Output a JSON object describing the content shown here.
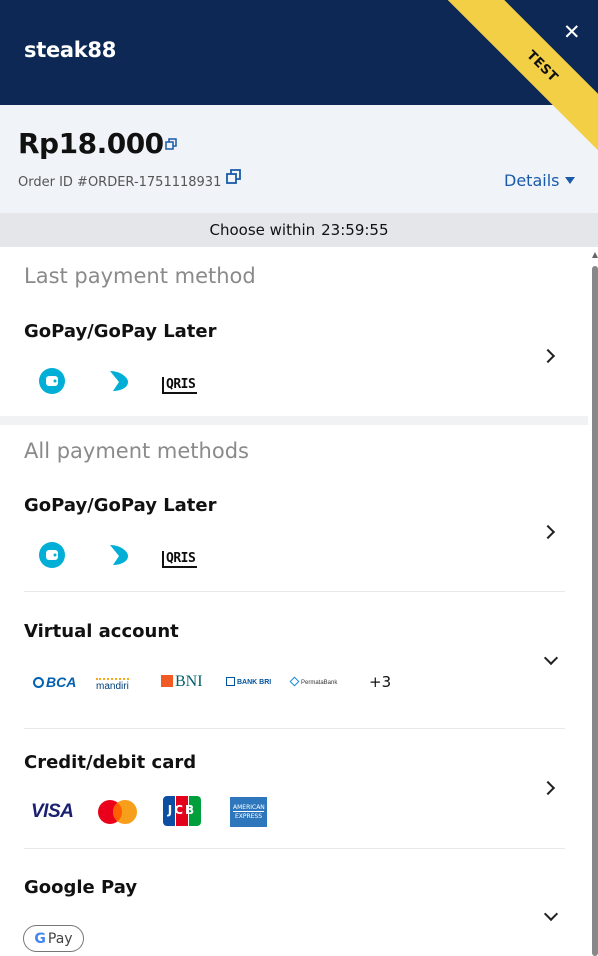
{
  "header": {
    "merchant": "steak88",
    "close_label": "✕",
    "badge": "TEST"
  },
  "summary": {
    "amount": "Rp18.000",
    "order_id": "Order ID #ORDER-1751118931",
    "details_label": "Details"
  },
  "timer": {
    "prefix": "Choose within",
    "countdown": "23:59:55"
  },
  "last_section": {
    "label": "Last payment method",
    "methods": [
      {
        "title": "GoPay/GoPay Later",
        "icons": [
          "gopay-wallet-icon",
          "gopay-later-icon",
          "qris-logo"
        ]
      }
    ]
  },
  "all_section": {
    "label": "All payment methods",
    "methods": [
      {
        "title": "GoPay/GoPay Later",
        "icons": [
          "gopay-wallet-icon",
          "gopay-later-icon",
          "qris-logo"
        ]
      },
      {
        "title": "Virtual account",
        "banks": [
          "BCA",
          "mandiri",
          "BNI",
          "BANK BRI",
          "Permata Bank"
        ],
        "more": "+3"
      },
      {
        "title": "Credit/debit card",
        "cards": [
          "VISA",
          "mastercard",
          "JCB",
          "AMERICAN EXPRESS"
        ]
      },
      {
        "title": "Google Pay",
        "badge": "Pay",
        "badge_g": "G"
      }
    ]
  },
  "logos": {
    "qris": "QRIS",
    "bca": "BCA",
    "mandiri": "mandiri",
    "bni": "BNI",
    "bri": "BANK BRI",
    "permata": "PermataBank",
    "visa": "VISA",
    "jcb": "JCB",
    "amex_top": "AMERICAN",
    "amex_bottom": "EXPRESS"
  },
  "colors": {
    "header_bg": "#0d2855",
    "ribbon": "#f3cf45",
    "link": "#1a5aa8",
    "gopay": "#00aed6",
    "bca": "#0060af",
    "bni": "#f15a23"
  }
}
